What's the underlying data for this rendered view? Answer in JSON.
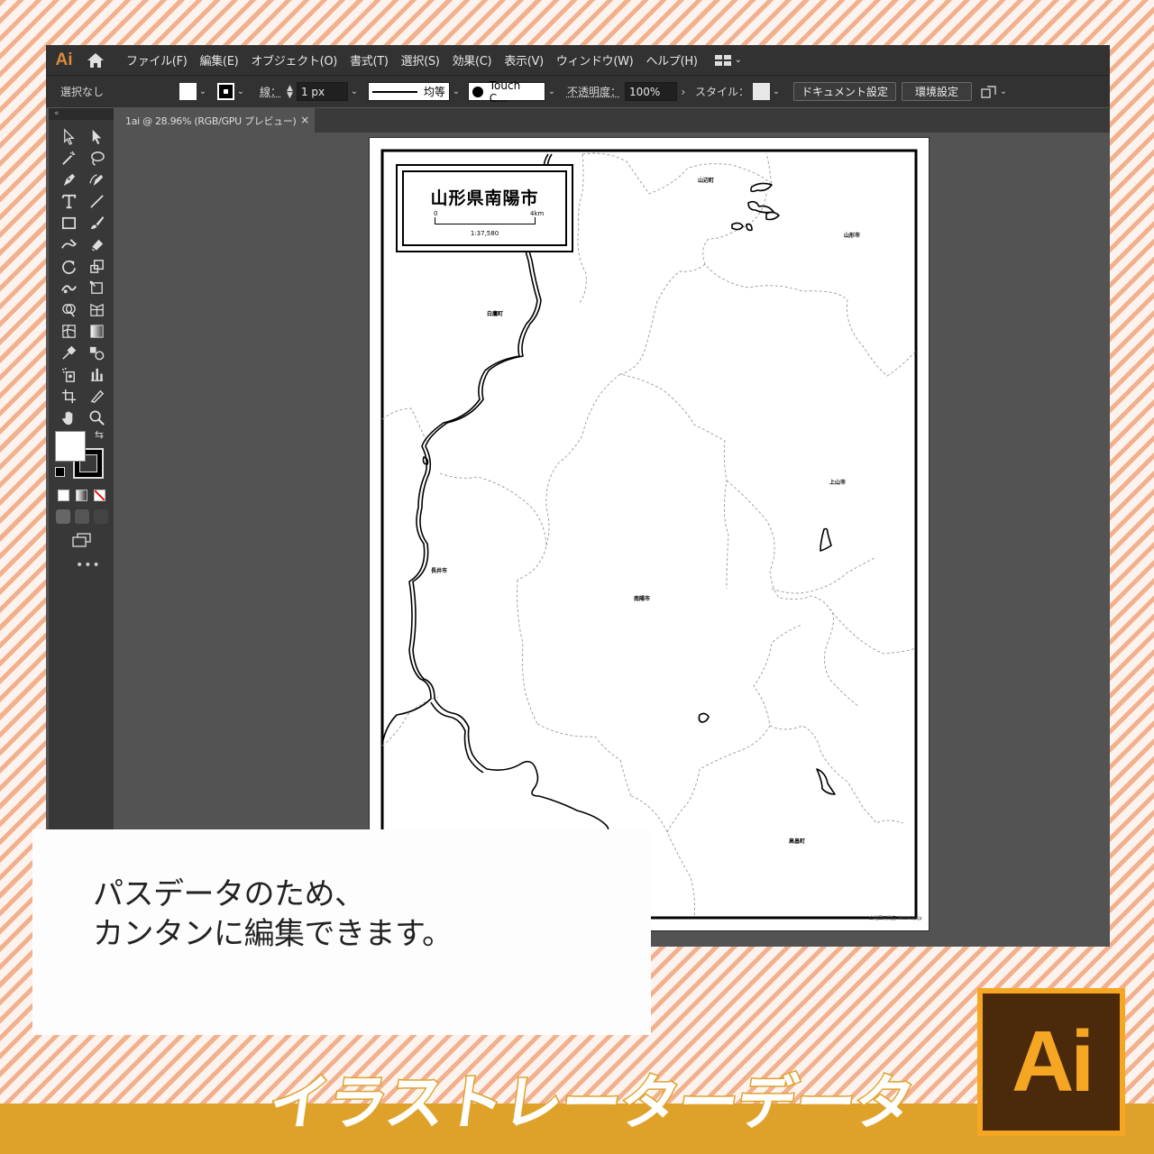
{
  "menubar": {
    "app_logo": "Ai",
    "items": [
      "ファイル(F)",
      "編集(E)",
      "オブジェクト(O)",
      "書式(T)",
      "選択(S)",
      "効果(C)",
      "表示(V)",
      "ウィンドウ(W)",
      "ヘルプ(H)"
    ]
  },
  "controlbar": {
    "selection_status": "選択なし",
    "stroke_label": "線：",
    "stroke_weight": "1 px",
    "stroke_profile": "均等",
    "brush": "Touch C...",
    "opacity_label": "不透明度：",
    "opacity": "100%",
    "style_label": "スタイル：",
    "document_setup": "ドキュメント設定",
    "preferences": "環境設定"
  },
  "tab": {
    "title": "1ai @ 28.96% (RGB/GPU プレビュー)",
    "close": "×"
  },
  "toolbar": {
    "collapse": "«",
    "more": "•••"
  },
  "map": {
    "title": "山形県南陽市",
    "scale_start": "0",
    "scale_end": "4km",
    "scale_ratio": "1:37,580",
    "towns": {
      "yamabe": "山辺町",
      "yamagata": "山形市",
      "shirataka": "白鷹町",
      "kaminoyama": "上山市",
      "nagai": "長井市",
      "nanyo": "南陽市",
      "takahata": "高畠町"
    },
    "credit": "白地図専門店 freemap.jp"
  },
  "caption": {
    "line1": "パスデータのため、",
    "line2": "カンタンに編集できます。"
  },
  "banner": {
    "text": "イラストレーターデータ",
    "badge": "Ai"
  },
  "colors": {
    "ai_orange": "#f5a623",
    "ai_brown": "#4b2a0c",
    "band": "#dea22a",
    "stripe": "#f2b08c"
  }
}
